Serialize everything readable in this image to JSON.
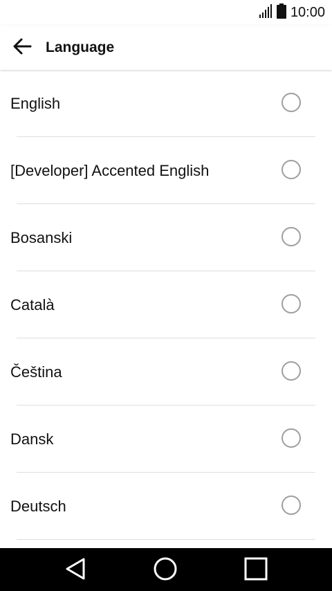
{
  "status_bar": {
    "time": "10:00",
    "signal_icon": "signal-icon",
    "battery_icon": "battery-icon"
  },
  "app_bar": {
    "title": "Language",
    "back_icon": "arrow-back-icon"
  },
  "languages": [
    {
      "label": "English",
      "selected": false
    },
    {
      "label": "[Developer] Accented English",
      "selected": false
    },
    {
      "label": "Bosanski",
      "selected": false
    },
    {
      "label": "Català",
      "selected": false
    },
    {
      "label": "Čeština",
      "selected": false
    },
    {
      "label": "Dansk",
      "selected": false
    },
    {
      "label": "Deutsch",
      "selected": false
    }
  ],
  "nav_bar": {
    "back_icon": "nav-back-icon",
    "home_icon": "nav-home-icon",
    "recents_icon": "nav-recents-icon"
  },
  "colors": {
    "radio_border": "#9e9e9e",
    "divider": "#dedede",
    "nav_background": "#000000"
  }
}
